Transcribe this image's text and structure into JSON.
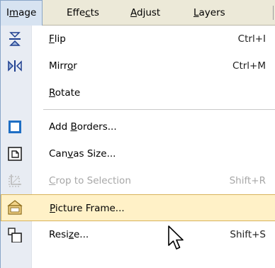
{
  "menubar": {
    "items": [
      {
        "pre": "I",
        "u": "m",
        "post": "age"
      },
      {
        "pre": "Effe",
        "u": "c",
        "post": "ts"
      },
      {
        "pre": "",
        "u": "A",
        "post": "djust"
      },
      {
        "pre": "",
        "u": "L",
        "post": "ayers"
      }
    ]
  },
  "menu": {
    "items": [
      {
        "icon": "flip-icon",
        "pre": "",
        "u": "F",
        "post": "lip",
        "shortcut": "Ctrl+I"
      },
      {
        "icon": "mirror-icon",
        "pre": "Mirr",
        "u": "o",
        "post": "r",
        "shortcut": "Ctrl+M"
      },
      {
        "icon": "",
        "pre": "",
        "u": "R",
        "post": "otate",
        "shortcut": ""
      },
      {
        "icon": "add-borders-icon",
        "pre": "Add ",
        "u": "B",
        "post": "orders...",
        "shortcut": ""
      },
      {
        "icon": "canvas-size-icon",
        "pre": "Can",
        "u": "v",
        "post": "as Size...",
        "shortcut": ""
      },
      {
        "icon": "crop-icon",
        "pre": "",
        "u": "C",
        "post": "rop to Selection",
        "shortcut": "Shift+R"
      },
      {
        "icon": "picture-frame-icon",
        "pre": "",
        "u": "P",
        "post": "icture Frame...",
        "shortcut": ""
      },
      {
        "icon": "resize-icon",
        "pre": "Resi",
        "u": "z",
        "post": "e...",
        "shortcut": "Shift+S"
      }
    ]
  },
  "colors": {
    "menubar_bg": "#ece9d8",
    "icon_strip_bg": "#e8ecf3",
    "hover_bg": "#fff1c7",
    "hover_border": "#d8b35a",
    "open_menu_bg": "#d7e3f1",
    "accent_blue": "#1f6fc4"
  }
}
